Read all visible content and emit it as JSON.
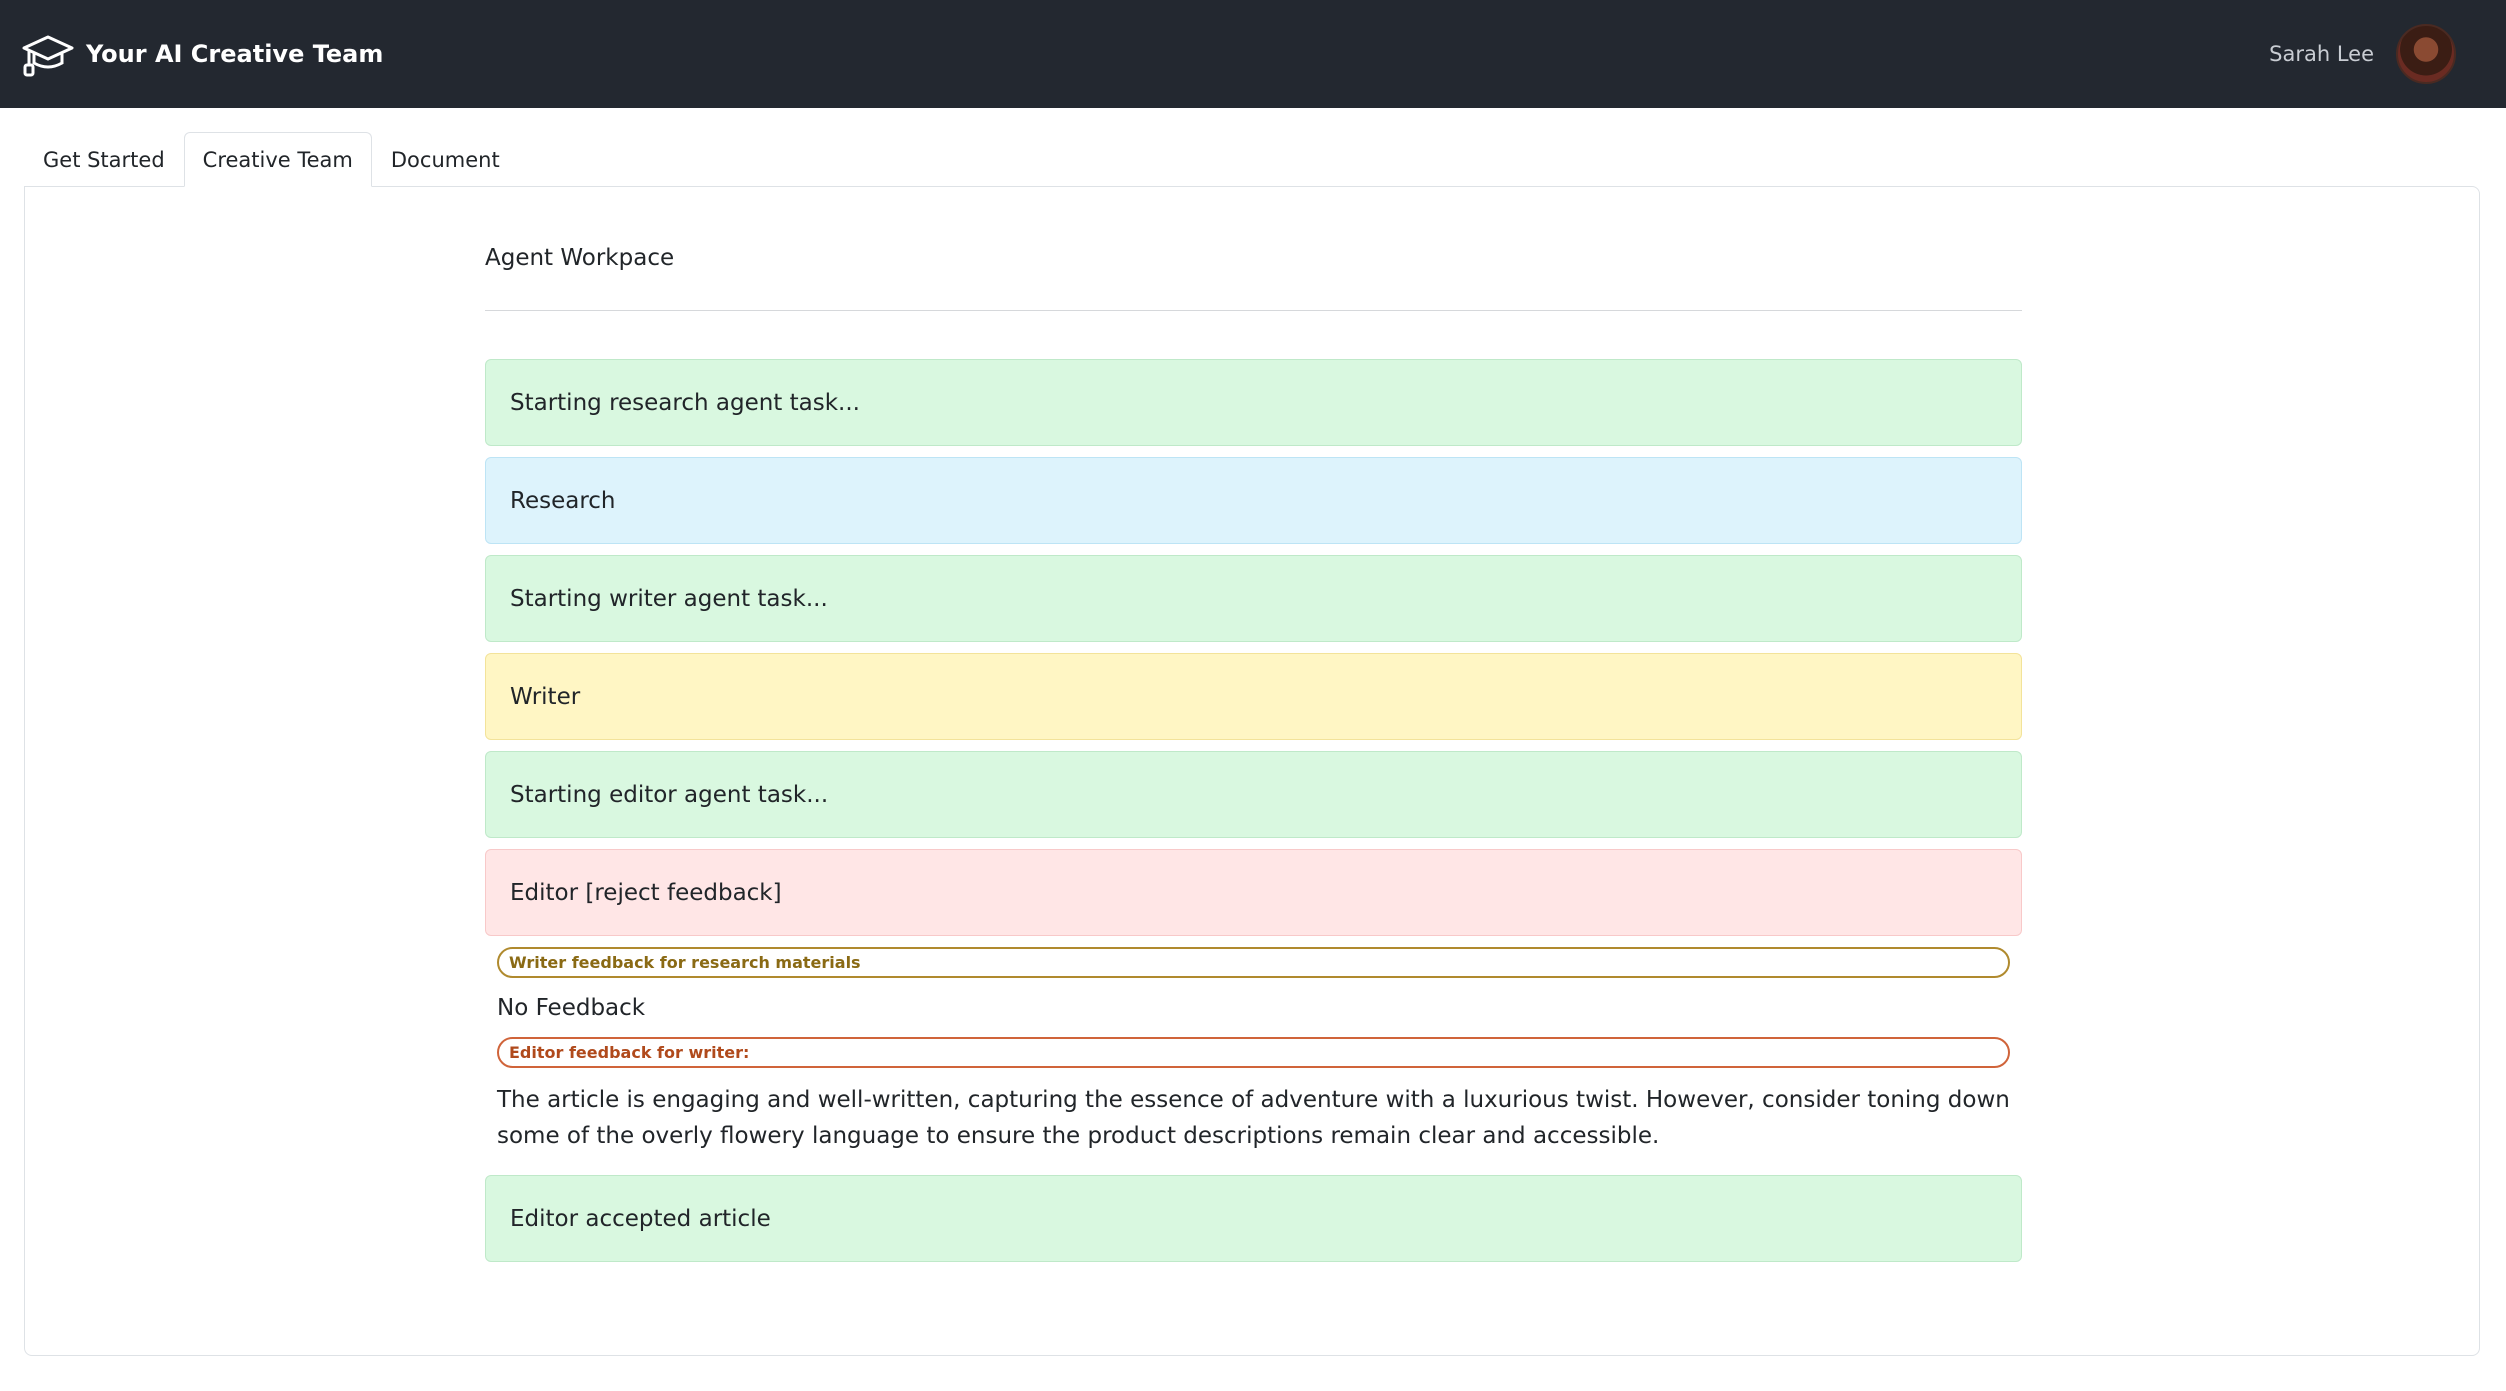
{
  "header": {
    "title": "Your AI Creative Team",
    "brand_icon": "graduation-cap-icon",
    "user_name": "Sarah Lee"
  },
  "tabs": [
    {
      "label": "Get Started",
      "active": false
    },
    {
      "label": "Creative Team",
      "active": true
    },
    {
      "label": "Document",
      "active": false
    }
  ],
  "workspace": {
    "title": "Agent Workpace",
    "messages": [
      {
        "text": "Starting research agent task...",
        "variant": "green"
      },
      {
        "text": "Research",
        "variant": "blue"
      },
      {
        "text": "Starting writer agent task...",
        "variant": "green"
      },
      {
        "text": "Writer",
        "variant": "yellow"
      },
      {
        "text": "Starting editor agent task...",
        "variant": "green"
      },
      {
        "text": "Editor [reject feedback]",
        "variant": "red"
      }
    ],
    "writer_feedback_label": "Writer feedback for research materials",
    "writer_feedback_text": "No Feedback",
    "editor_feedback_label": "Editor feedback for writer:",
    "editor_feedback_text": "The article is engaging and well-written, capturing the essence of adventure with a luxurious twist. However, consider toning down some of the overly flowery language to ensure the product descriptions remain clear and accessible.",
    "final_message": "Editor accepted article"
  },
  "colors": {
    "navbar": "#232830",
    "success_bg": "#d9f8e0",
    "info_bg": "#ddf3fc",
    "warning_bg": "#fff6c4",
    "danger_bg": "#ffe6e6"
  }
}
